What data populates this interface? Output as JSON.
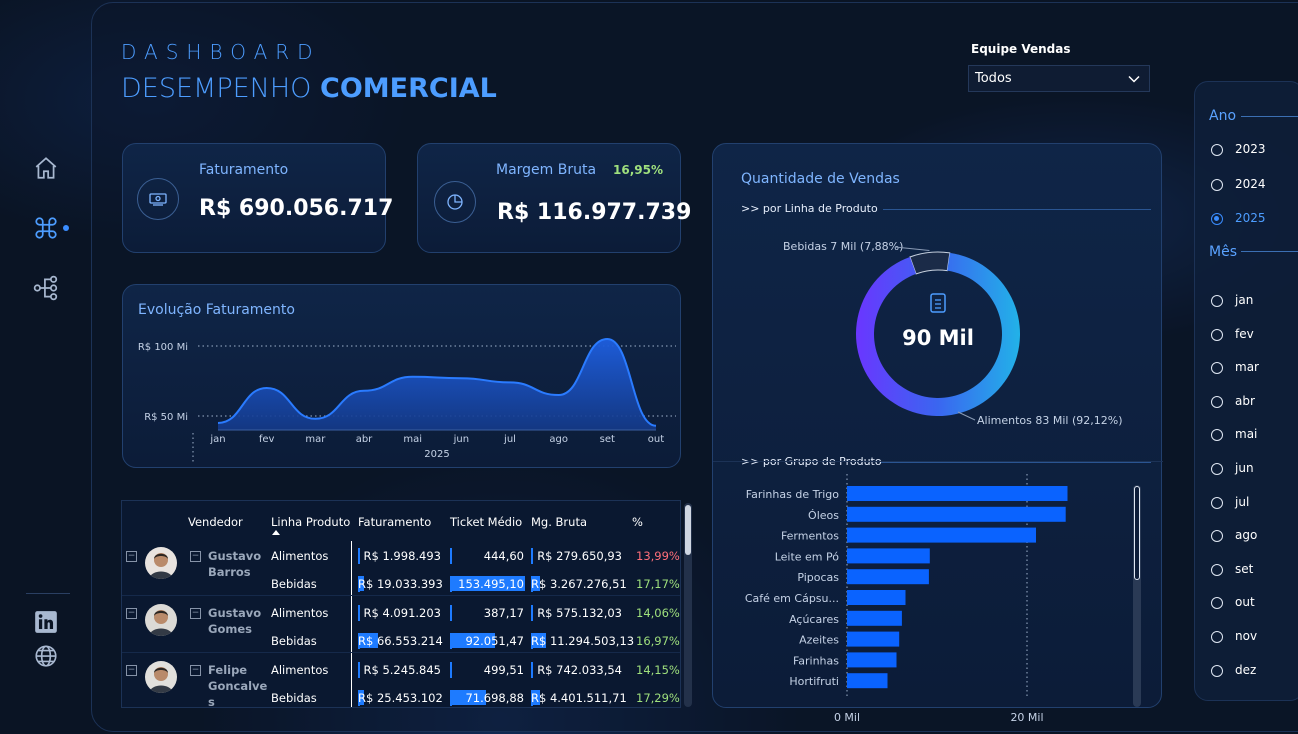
{
  "header": {
    "title_top": "DASHBOARD",
    "title_light": "DESEMPENHO",
    "title_bold": "COMERCIAL"
  },
  "filter": {
    "label": "Equipe Vendas",
    "value": "Todos"
  },
  "nav": {
    "items": [
      "home-icon",
      "command-icon",
      "hierarchy-icon"
    ],
    "social": [
      "linkedin-icon",
      "globe-icon"
    ]
  },
  "kpis": {
    "faturamento": {
      "label": "Faturamento",
      "value": "R$ 690.056.717",
      "icon": "money-icon"
    },
    "margem": {
      "label": "Margem Bruta",
      "value": "R$ 116.977.739",
      "pct": "16,95%",
      "icon": "pie-icon"
    }
  },
  "evolucao": {
    "title": "Evolução Faturamento",
    "year": "2025",
    "chart_data": {
      "type": "area",
      "categories": [
        "jan",
        "fev",
        "mar",
        "abr",
        "mai",
        "jun",
        "jul",
        "ago",
        "set",
        "out"
      ],
      "values": [
        45,
        70,
        48,
        68,
        78,
        77,
        74,
        65,
        105,
        43
      ],
      "ytick_labels": [
        "R$ 50 Mi",
        "R$ 100 Mi"
      ],
      "yticks": [
        50,
        100
      ],
      "ylim": [
        40,
        115
      ],
      "grid": true,
      "color": "#1e6bff"
    }
  },
  "table": {
    "headers": [
      "Vendedor",
      "Linha Produto",
      "Faturamento",
      "Ticket Médio",
      "Mg. Bruta",
      "%"
    ],
    "rows": [
      {
        "name": "Gustavo Barros",
        "name_lines": [
          "Gustavo",
          "Barros"
        ],
        "lines": [
          {
            "produto": "Alimentos",
            "fat": "R$ 1.998.493",
            "ticket": "444,60",
            "mg": "R$ 279.650,93",
            "pct": "13,99%",
            "fat_bar": 0.02,
            "ticket_bar": 0,
            "mg_bar": 0.02
          },
          {
            "produto": "Bebidas",
            "fat": "R$ 19.033.393",
            "ticket": "153.495,10",
            "mg": "R$ 3.267.276,51",
            "pct": "17,17%",
            "fat_bar": 0.08,
            "ticket_bar": 0.96,
            "mg_bar": 0.1
          }
        ]
      },
      {
        "name": "Gustavo Gomes",
        "name_lines": [
          "Gustavo",
          "Gomes"
        ],
        "lines": [
          {
            "produto": "Alimentos",
            "fat": "R$ 4.091.203",
            "ticket": "387,17",
            "mg": "R$ 575.132,03",
            "pct": "14,06%",
            "fat_bar": 0.02,
            "ticket_bar": 0,
            "mg_bar": 0.02
          },
          {
            "produto": "Bebidas",
            "fat": "R$ 66.553.214",
            "ticket": "92.051,47",
            "mg": "R$ 11.294.503,13",
            "pct": "16,97%",
            "fat_bar": 0.25,
            "ticket_bar": 0.58,
            "mg_bar": 0.17
          }
        ]
      },
      {
        "name": "Felipe Goncalves",
        "name_lines": [
          "Felipe",
          "Goncalve",
          "s"
        ],
        "lines": [
          {
            "produto": "Alimentos",
            "fat": "R$ 5.245.845",
            "ticket": "499,51",
            "mg": "R$ 742.033,54",
            "pct": "14,15%",
            "fat_bar": 0.02,
            "ticket_bar": 0,
            "mg_bar": 0.02
          },
          {
            "produto": "Bebidas",
            "fat": "R$ 25.453.102",
            "ticket": "71.698,88",
            "mg": "R$ 4.401.511,71",
            "pct": "17,29%",
            "fat_bar": 0.08,
            "ticket_bar": 0.46,
            "mg_bar": 0.1
          }
        ]
      }
    ]
  },
  "quantidade": {
    "title": "Quantidade de Vendas",
    "sub_linha": ">> por Linha de Produto",
    "sub_grupo": ">> por Grupo de Produto",
    "donut": {
      "type": "pie",
      "center": "90 Mil",
      "center_icon": "document-icon",
      "slices": [
        {
          "label": "Bebidas 7 Mil (7,88%)",
          "value": 7.88
        },
        {
          "label": "Alimentos 83 Mil (92,12%)",
          "value": 92.12
        }
      ]
    },
    "bars": {
      "type": "bar",
      "orientation": "horizontal",
      "categories": [
        "Farinhas de Trigo",
        "Óleos",
        "Fermentos",
        "Leite em Pó",
        "Pipocas",
        "Café em Cápsu...",
        "Açúcares",
        "Azeites",
        "Farinhas",
        "Hortifruti"
      ],
      "values": [
        24.5,
        24.3,
        21.0,
        9.2,
        9.1,
        6.5,
        6.1,
        5.8,
        5.5,
        4.5
      ],
      "xtick_labels": [
        "0 Mil",
        "20 Mil"
      ],
      "xticks": [
        0,
        20
      ],
      "color": "#0a63ff"
    }
  },
  "sidebar": {
    "ano_label": "Ano",
    "anos": [
      "2023",
      "2024",
      "2025"
    ],
    "ano_selected": "2025",
    "mes_label": "Mês",
    "meses": [
      "jan",
      "fev",
      "mar",
      "abr",
      "mai",
      "jun",
      "jul",
      "ago",
      "set",
      "out",
      "nov",
      "dez"
    ]
  }
}
